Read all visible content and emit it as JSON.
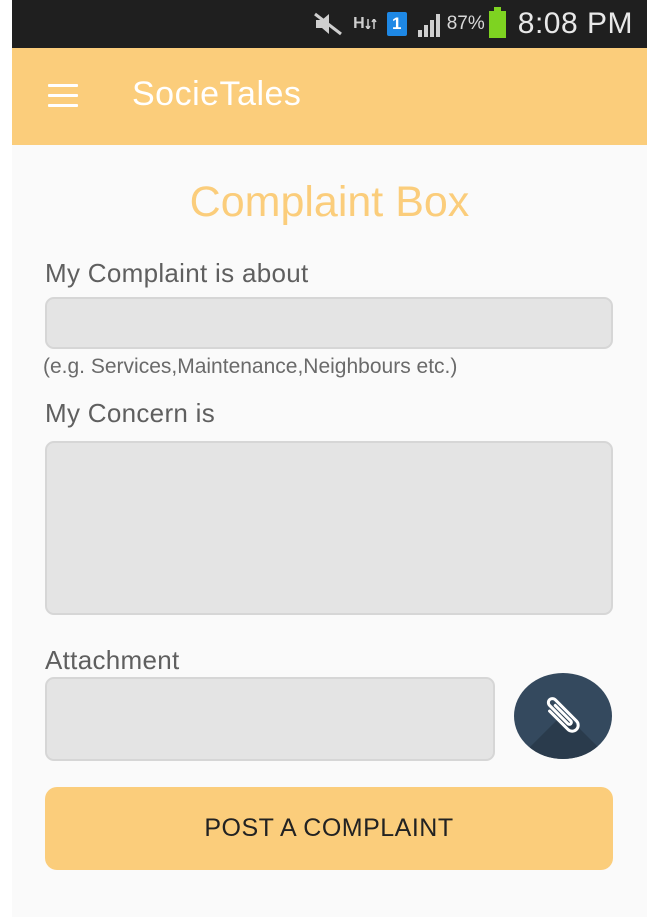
{
  "status_bar": {
    "battery_percent": "87%",
    "time": "8:08 PM",
    "sim_label": "1",
    "network_label": "H",
    "icons": [
      "mute-icon",
      "network-h-icon",
      "sim-1-icon",
      "signal-icon",
      "battery-icon"
    ]
  },
  "app_bar": {
    "title": "SocieTales",
    "menu_icon": "hamburger-menu-icon",
    "color": "#fbcd7b"
  },
  "form": {
    "title": "Complaint Box",
    "complaint_about_label": "My Complaint is about",
    "complaint_about_value": "",
    "complaint_about_hint": "(e.g. Services,Maintenance,Neighbours etc.)",
    "concern_label": "My Concern is",
    "concern_value": "",
    "attachment_label": "Attachment",
    "attachment_value": "",
    "attach_icon": "paperclip-icon",
    "submit_label": "POST A COMPLAINT"
  },
  "colors": {
    "accent": "#fbcd7b",
    "attach_button": "#34495e",
    "field_bg": "#e4e4e4"
  }
}
